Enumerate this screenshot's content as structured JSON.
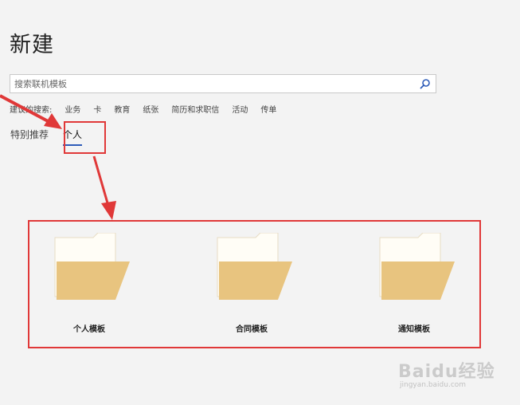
{
  "page": {
    "title": "新建"
  },
  "search": {
    "placeholder": "搜索联机模板"
  },
  "suggested_searches": {
    "label": "建议的搜索:",
    "terms": [
      "业务",
      "卡",
      "教育",
      "纸张",
      "简历和求职信",
      "活动",
      "传单"
    ]
  },
  "tabs": [
    {
      "label": "特别推荐",
      "active": false
    },
    {
      "label": "个人",
      "active": true
    }
  ],
  "folders": [
    {
      "label": "个人模板"
    },
    {
      "label": "合同模板"
    },
    {
      "label": "通知模板"
    }
  ],
  "watermark": {
    "logo": "Baidu经验",
    "url": "jingyan.baidu.com"
  },
  "colors": {
    "highlight": "#e03838",
    "accent": "#2e5cb8",
    "folder_front": "#e8c47f",
    "folder_back": "#fffdf6"
  }
}
